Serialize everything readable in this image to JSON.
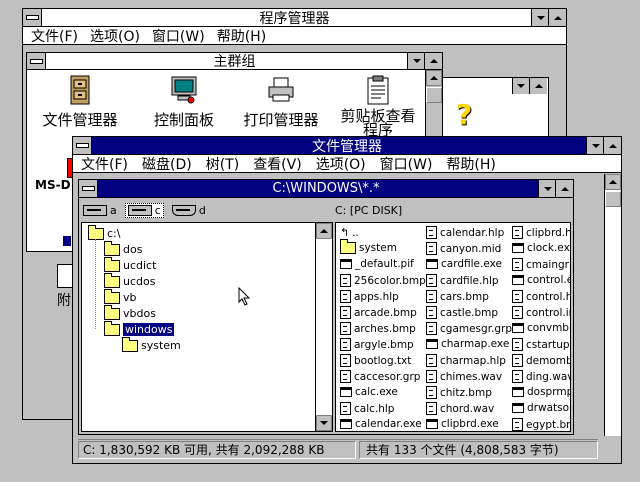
{
  "program_manager": {
    "title": "程序管理器",
    "menu": [
      "文件(F)",
      "选项(O)",
      "窗口(W)",
      "帮助(H)"
    ]
  },
  "main_group": {
    "title": "主群组",
    "icons": [
      {
        "label": "文件管理器",
        "icon": "file-cabinet-icon"
      },
      {
        "label": "控制面板",
        "icon": "control-panel-icon"
      },
      {
        "label": "打印管理器",
        "icon": "printer-icon"
      },
      {
        "label": "剪贴板查看",
        "label2": "程序",
        "icon": "clipboard-icon"
      }
    ],
    "partial_labels": [
      "MS-D",
      "附"
    ]
  },
  "file_manager": {
    "title": "文件管理器",
    "menu": [
      "文件(F)",
      "磁盘(D)",
      "树(T)",
      "查看(V)",
      "选项(O)",
      "窗口(W)",
      "帮助(H)"
    ],
    "dir_window_title": "C:\\WINDOWS\\*.*",
    "drives": [
      {
        "letter": "a",
        "icon": "floppy-drive-icon"
      },
      {
        "letter": "c",
        "icon": "hard-drive-icon",
        "selected": true
      },
      {
        "letter": "d",
        "icon": "cdrom-drive-icon"
      }
    ],
    "volume_label": "C: [PC DISK]",
    "tree": [
      {
        "name": "c:\\",
        "indent": 0
      },
      {
        "name": "dos",
        "indent": 1
      },
      {
        "name": "ucdict",
        "indent": 1
      },
      {
        "name": "ucdos",
        "indent": 1
      },
      {
        "name": "vb",
        "indent": 1
      },
      {
        "name": "vbdos",
        "indent": 1
      },
      {
        "name": "windows",
        "indent": 1,
        "selected": true
      },
      {
        "name": "system",
        "indent": 2
      }
    ],
    "files_col1": [
      {
        "name": "..",
        "type": "up"
      },
      {
        "name": "system",
        "type": "folder"
      },
      {
        "name": "_default.pif",
        "type": "exe"
      },
      {
        "name": "256color.bmp",
        "type": "doc"
      },
      {
        "name": "apps.hlp",
        "type": "doc"
      },
      {
        "name": "arcade.bmp",
        "type": "doc"
      },
      {
        "name": "arches.bmp",
        "type": "doc"
      },
      {
        "name": "argyle.bmp",
        "type": "doc"
      },
      {
        "name": "bootlog.txt",
        "type": "doc"
      },
      {
        "name": "caccesor.grp",
        "type": "doc"
      },
      {
        "name": "calc.exe",
        "type": "exe"
      },
      {
        "name": "calc.hlp",
        "type": "doc"
      },
      {
        "name": "calendar.exe",
        "type": "exe"
      }
    ],
    "files_col2": [
      {
        "name": "calendar.hlp",
        "type": "doc"
      },
      {
        "name": "canyon.mid",
        "type": "doc"
      },
      {
        "name": "cardfile.exe",
        "type": "exe"
      },
      {
        "name": "cardfile.hlp",
        "type": "doc"
      },
      {
        "name": "cars.bmp",
        "type": "doc"
      },
      {
        "name": "castle.bmp",
        "type": "doc"
      },
      {
        "name": "cgamesgr.grp",
        "type": "doc"
      },
      {
        "name": "charmap.exe",
        "type": "exe"
      },
      {
        "name": "charmap.hlp",
        "type": "doc"
      },
      {
        "name": "chimes.wav",
        "type": "doc"
      },
      {
        "name": "chitz.bmp",
        "type": "doc"
      },
      {
        "name": "chord.wav",
        "type": "doc"
      },
      {
        "name": "clipbrd.exe",
        "type": "exe"
      }
    ],
    "files_col3": [
      {
        "name": "clipbrd.hlp",
        "type": "doc"
      },
      {
        "name": "clock.exe",
        "type": "exe"
      },
      {
        "name": "cmaingrp.",
        "type": "doc"
      },
      {
        "name": "control.ex",
        "type": "exe"
      },
      {
        "name": "control.hlp",
        "type": "doc"
      },
      {
        "name": "control.ini",
        "type": "doc"
      },
      {
        "name": "convmb.e",
        "type": "exe"
      },
      {
        "name": "cstartup.g",
        "type": "doc"
      },
      {
        "name": "demomb.t",
        "type": "doc"
      },
      {
        "name": "ding.wav",
        "type": "doc"
      },
      {
        "name": "dosprmpt.",
        "type": "exe"
      },
      {
        "name": "drwatson.",
        "type": "exe"
      },
      {
        "name": "egypt.bmp",
        "type": "doc"
      }
    ],
    "status_left": "C: 1,830,592 KB 可用, 共有 2,092,288 KB",
    "status_right": "共有 133 个文件 (4,808,583 字节)"
  },
  "colors": {
    "active_title": "#000080",
    "desktop": "#c0c0c0",
    "folder_yellow": "#ffff80"
  }
}
